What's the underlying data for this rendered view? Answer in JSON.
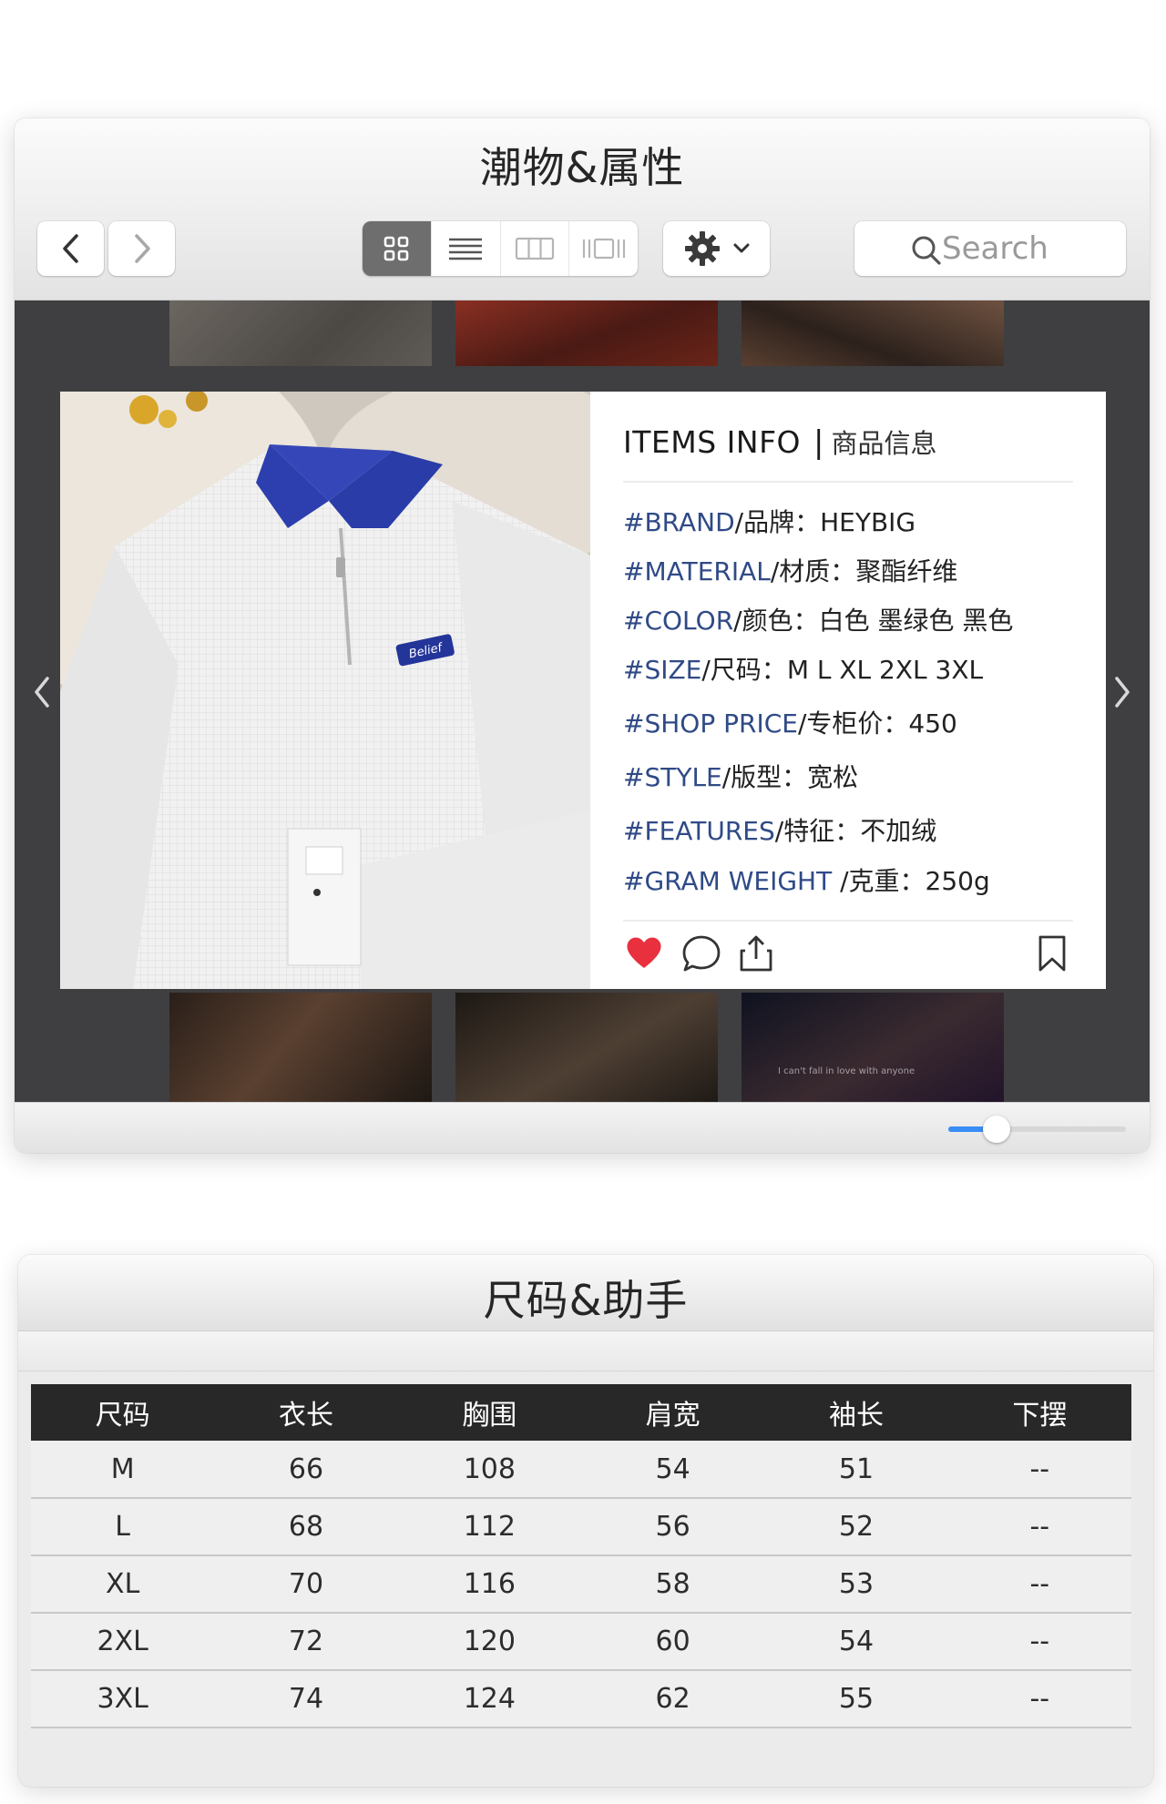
{
  "window1": {
    "title": "潮物&属性",
    "search_placeholder": "Search",
    "view_modes": [
      "grid-view",
      "list-view",
      "column-view",
      "gallery-view"
    ],
    "active_view": "grid-view",
    "zoom_slider": 0.27
  },
  "info": {
    "title_en": "ITEMS INFO",
    "separator": "|",
    "title_cn": "商品信息",
    "attributes": [
      {
        "key": "#BRAND",
        "label": "/品牌：",
        "value": "HEYBIG"
      },
      {
        "key": "#MATERIAL",
        "label": "/材质：",
        "value": "聚酯纤维"
      },
      {
        "key": "#COLOR",
        "label": "/颜色：",
        "value": "白色 墨绿色 黑色"
      },
      {
        "key": "#SIZE",
        "label": "/尺码：",
        "value": "M L XL 2XL 3XL"
      },
      {
        "key": "#SHOP PRICE",
        "label": "/专柜价：",
        "value": "450"
      },
      {
        "key": "#STYLE",
        "label": "/版型：",
        "value": "宽松"
      },
      {
        "key": "#FEATURES",
        "label": "/特征：",
        "value": "不加绒"
      },
      {
        "key": "#GRAM WEIGHT",
        "label": " /克重：",
        "value": "250g"
      }
    ],
    "product_label": "Belief",
    "thumb_caption": "I can't fall in love with anyone"
  },
  "window2": {
    "title": "尺码&助手",
    "columns": [
      "尺码",
      "衣长",
      "胸围",
      "肩宽",
      "袖长",
      "下摆"
    ],
    "rows": [
      [
        "M",
        "66",
        "108",
        "54",
        "51",
        "--"
      ],
      [
        "L",
        "68",
        "112",
        "56",
        "52",
        "--"
      ],
      [
        "XL",
        "70",
        "116",
        "58",
        "53",
        "--"
      ],
      [
        "2XL",
        "72",
        "120",
        "60",
        "54",
        "--"
      ],
      [
        "3XL",
        "74",
        "124",
        "62",
        "55",
        "--"
      ]
    ]
  },
  "colors": {
    "accent_blue": "#3a8df5",
    "attribute_key": "#2f4a86",
    "heart": "#e8303f",
    "table_header": "#282828"
  }
}
